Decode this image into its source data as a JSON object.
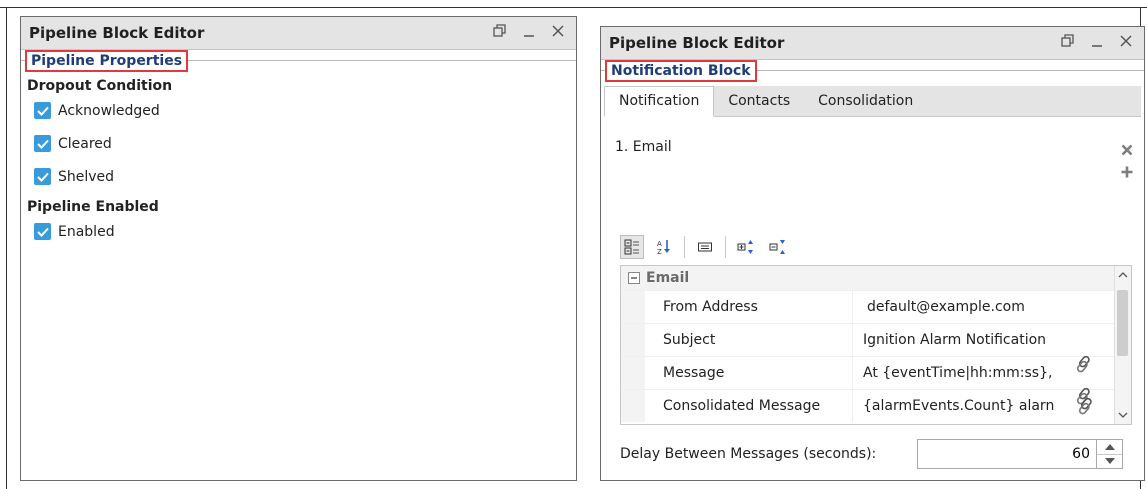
{
  "left_panel": {
    "title": "Pipeline Block Editor",
    "section_label": "Pipeline Properties",
    "groups": [
      {
        "title": "Dropout Condition",
        "options": [
          {
            "label": "Acknowledged",
            "checked": true
          },
          {
            "label": "Cleared",
            "checked": true
          },
          {
            "label": "Shelved",
            "checked": true
          }
        ]
      },
      {
        "title": "Pipeline Enabled",
        "options": [
          {
            "label": "Enabled",
            "checked": true
          }
        ]
      }
    ]
  },
  "right_panel": {
    "title": "Pipeline Block Editor",
    "section_label": "Notification Block",
    "tabs": [
      {
        "label": "Notification",
        "active": true
      },
      {
        "label": "Contacts",
        "active": false
      },
      {
        "label": "Consolidation",
        "active": false
      }
    ],
    "profile_list": [
      {
        "label": "1. Email"
      }
    ],
    "property_grid": {
      "category": "Email",
      "rows": [
        {
          "name": "From Address",
          "value": "default@example.com",
          "link": false
        },
        {
          "name": "Subject",
          "value": "Ignition Alarm Notification",
          "link": true
        },
        {
          "name": "Message",
          "value": "At {eventTime|hh:mm:ss},",
          "link": true
        },
        {
          "name": "Consolidated Message",
          "value": "{alarmEvents.Count} alarn",
          "link": true
        }
      ]
    },
    "delay": {
      "label": "Delay Between Messages (seconds):",
      "value": "60"
    }
  },
  "colors": {
    "highlight_border": "#e0393e",
    "section_text": "#1f3d7a",
    "checkbox": "#3a9bdc",
    "titlebar": "#e4e4e4"
  },
  "icons": {
    "window_restore": "restore-icon",
    "window_minimize": "minimize-icon",
    "window_close": "close-icon",
    "remove_item": "remove-x-icon",
    "add_item": "add-plus-icon",
    "toolbar": [
      "categorized-icon",
      "alphabetical-sort-icon",
      "property-pages-icon",
      "expand-all-icon",
      "collapse-all-icon"
    ],
    "binding": "binding-link-icon"
  }
}
